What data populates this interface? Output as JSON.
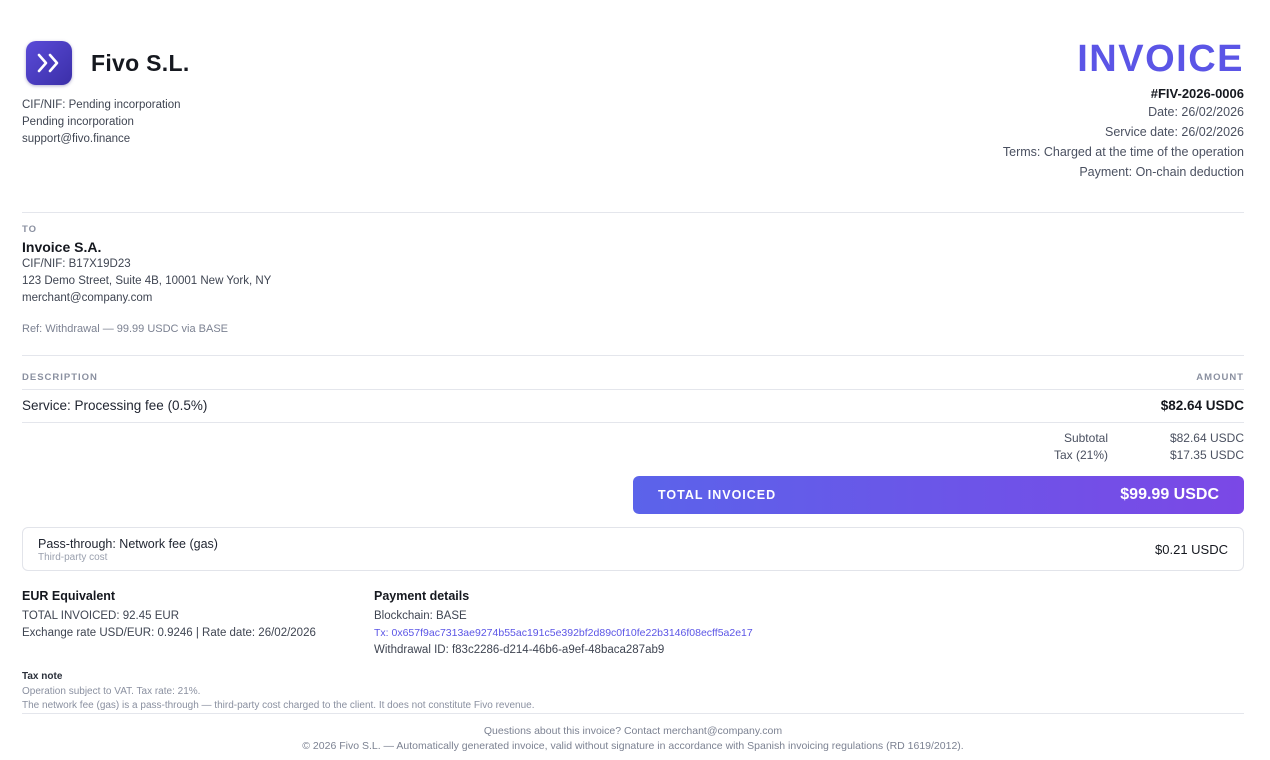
{
  "company": {
    "name": "Fivo S.L.",
    "lines": [
      "CIF/NIF: Pending incorporation",
      "Pending incorporation",
      "support@fivo.finance"
    ]
  },
  "invoice": {
    "title": "INVOICE",
    "number": "#FIV-2026-0006",
    "meta": [
      "Date: 26/02/2026",
      "Service date: 26/02/2026",
      "Terms: Charged at the time of the operation",
      "Payment: On-chain deduction"
    ]
  },
  "client": {
    "label": "TO",
    "name": "Invoice S.A.",
    "lines": [
      "CIF/NIF: B17X19D23",
      "123 Demo Street, Suite 4B, 10001 New York, NY",
      "merchant@company.com"
    ],
    "ref": "Ref: Withdrawal — 99.99 USDC via BASE"
  },
  "table": {
    "col_description": "DESCRIPTION",
    "col_amount": "AMOUNT",
    "rows": [
      {
        "description": "Service: Processing fee (0.5%)",
        "amount": "$82.64 USDC"
      }
    ]
  },
  "summary": {
    "subtotal_label": "Subtotal",
    "subtotal_value": "$82.64 USDC",
    "tax_label": "Tax (21%)",
    "tax_value": "$17.35 USDC",
    "total_label": "TOTAL INVOICED",
    "total_value": "$99.99 USDC"
  },
  "passthrough": {
    "title": "Pass-through: Network fee (gas)",
    "subtitle": "Third-party cost",
    "value": "$0.21 USDC"
  },
  "eur": {
    "title": "EUR Equivalent",
    "lines": [
      "TOTAL INVOICED: 92.45 EUR",
      "Exchange rate USD/EUR: 0.9246 | Rate date: 26/02/2026"
    ]
  },
  "payment": {
    "title": "Payment details",
    "blockchain": "Blockchain: BASE",
    "tx": "Tx: 0x657f9ac7313ae9274b55ac191c5e392bf2d89c0f10fe22b3146f08ecff5a2e17",
    "withdrawal": "Withdrawal ID: f83c2286-d214-46b6-a9ef-48baca287ab9"
  },
  "tax_note": {
    "title": "Tax note",
    "lines": [
      "Operation subject to VAT. Tax rate: 21%.",
      "The network fee (gas) is a pass-through — third-party cost charged to the client. It does not constitute Fivo revenue."
    ]
  },
  "footer": {
    "contact": "Questions about this invoice? Contact merchant@company.com",
    "legal": "© 2026 Fivo S.L. — Automatically generated invoice, valid without signature in accordance with Spanish invoicing regulations (RD 1619/2012)."
  },
  "colors": {
    "accent": "#5b55e6",
    "gradient_start": "#5b63ea",
    "gradient_end": "#7b48e6"
  },
  "icons": {
    "logo": "double-chevron-right-icon"
  }
}
